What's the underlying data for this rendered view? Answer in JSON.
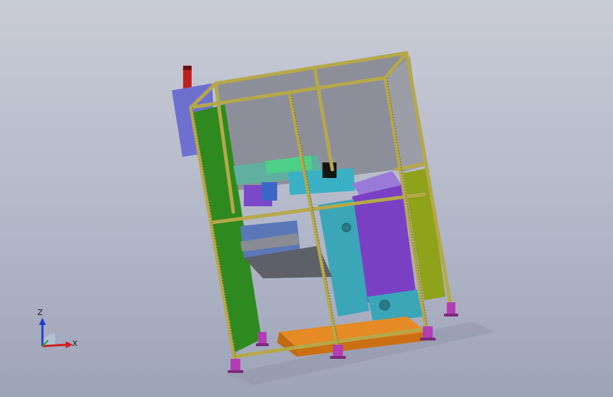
{
  "triad": {
    "z_label": "Z",
    "x_label": "X",
    "z_color": "#2040d0",
    "x_color": "#d02020",
    "y_color": "#20a020"
  },
  "model": {
    "frame_color": "#b5a84a",
    "glass_color": "#8c8f99",
    "left_panel_color": "#2e8a1e",
    "right_panel_color": "#8ea21a",
    "cabinet_color": "#7068c8",
    "base_color": "#e07a18",
    "foot_color": "#b43cb4",
    "column_color": "#3aa6b8",
    "housing_color": "#7a40c4",
    "beacon_color": "#c02020"
  }
}
